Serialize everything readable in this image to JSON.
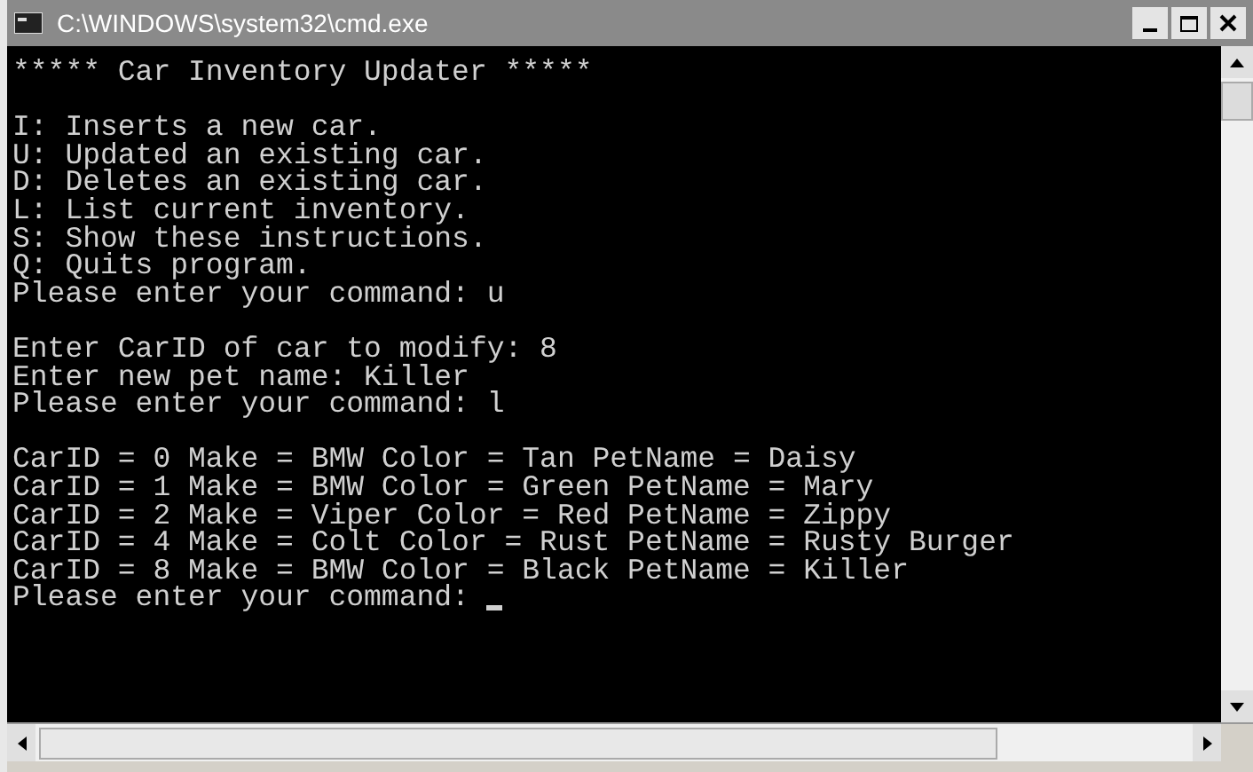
{
  "window": {
    "title": "C:\\WINDOWS\\system32\\cmd.exe"
  },
  "console": {
    "blocks": [
      [
        "***** Car Inventory Updater *****"
      ],
      [
        "I: Inserts a new car.",
        "U: Updated an existing car.",
        "D: Deletes an existing car.",
        "L: List current inventory.",
        "S: Show these instructions.",
        "Q: Quits program.",
        "Please enter your command: u"
      ],
      [
        "Enter CarID of car to modify: 8",
        "Enter new pet name: Killer",
        "Please enter your command: l"
      ],
      [
        "CarID = 0 Make = BMW Color = Tan PetName = Daisy",
        "CarID = 1 Make = BMW Color = Green PetName = Mary",
        "CarID = 2 Make = Viper Color = Red PetName = Zippy",
        "CarID = 4 Make = Colt Color = Rust PetName = Rusty Burger",
        "CarID = 8 Make = BMW Color = Black PetName = Killer",
        "Please enter your command: "
      ]
    ],
    "cursor": true
  }
}
